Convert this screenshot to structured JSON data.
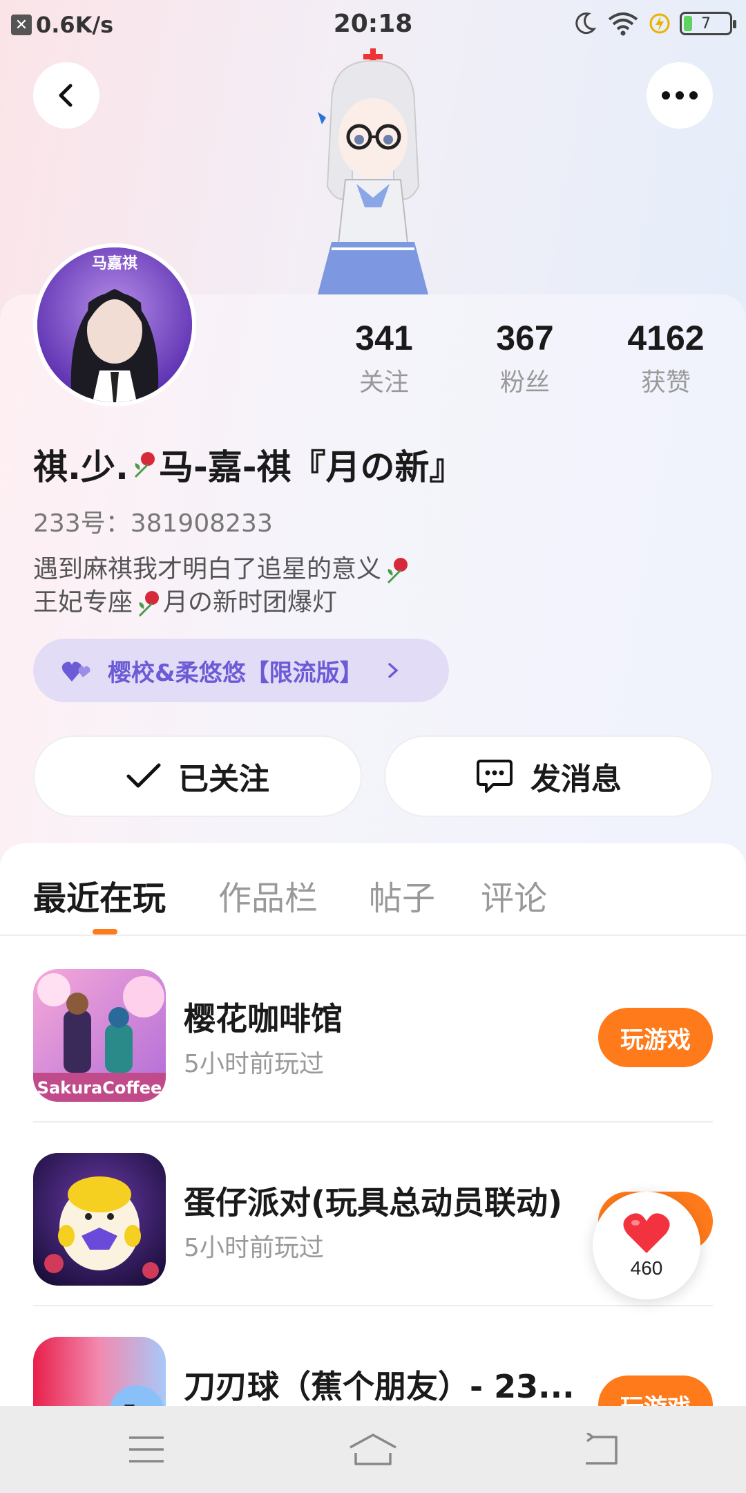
{
  "status_bar": {
    "net_speed": "0.6K/s",
    "time": "20:18",
    "battery": "7"
  },
  "profile": {
    "stats": [
      {
        "value": "341",
        "label": "关注"
      },
      {
        "value": "367",
        "label": "粉丝"
      },
      {
        "value": "4162",
        "label": "获赞"
      }
    ],
    "nickname_part1": "祺.少.",
    "nickname_part2": "马-嘉-祺『月の新』",
    "uid": "233号：381908233",
    "bio_line1": "遇到麻祺我才明白了追星的意义",
    "bio_line2_a": "王妃专座",
    "bio_line2_b": "月の新时团爆灯",
    "tag_label": "樱校&柔悠悠【限流版】",
    "avatar_text": "马嘉祺"
  },
  "actions": {
    "follow_label": "已关注",
    "message_label": "发消息"
  },
  "tabs": [
    {
      "label": "最近在玩"
    },
    {
      "label": "作品栏"
    },
    {
      "label": "帖子"
    },
    {
      "label": "评论"
    }
  ],
  "games": [
    {
      "title": "樱花咖啡馆",
      "subtitle": "5小时前玩过",
      "button": "玩游戏",
      "icon_text": "SakuraCoffee"
    },
    {
      "title": "蛋仔派对(玩具总动员联动)",
      "subtitle": "5小时前玩过",
      "button": "玩游戏"
    },
    {
      "title": "刀刃球（蕉个朋友）- 23...",
      "subtitle": "",
      "button": "玩游戏"
    }
  ],
  "like_float": {
    "count": "460"
  },
  "colors": {
    "accent": "#ff7a1a",
    "tag_text": "#6b5bd6",
    "tag_bg": "#e3dcf6"
  }
}
